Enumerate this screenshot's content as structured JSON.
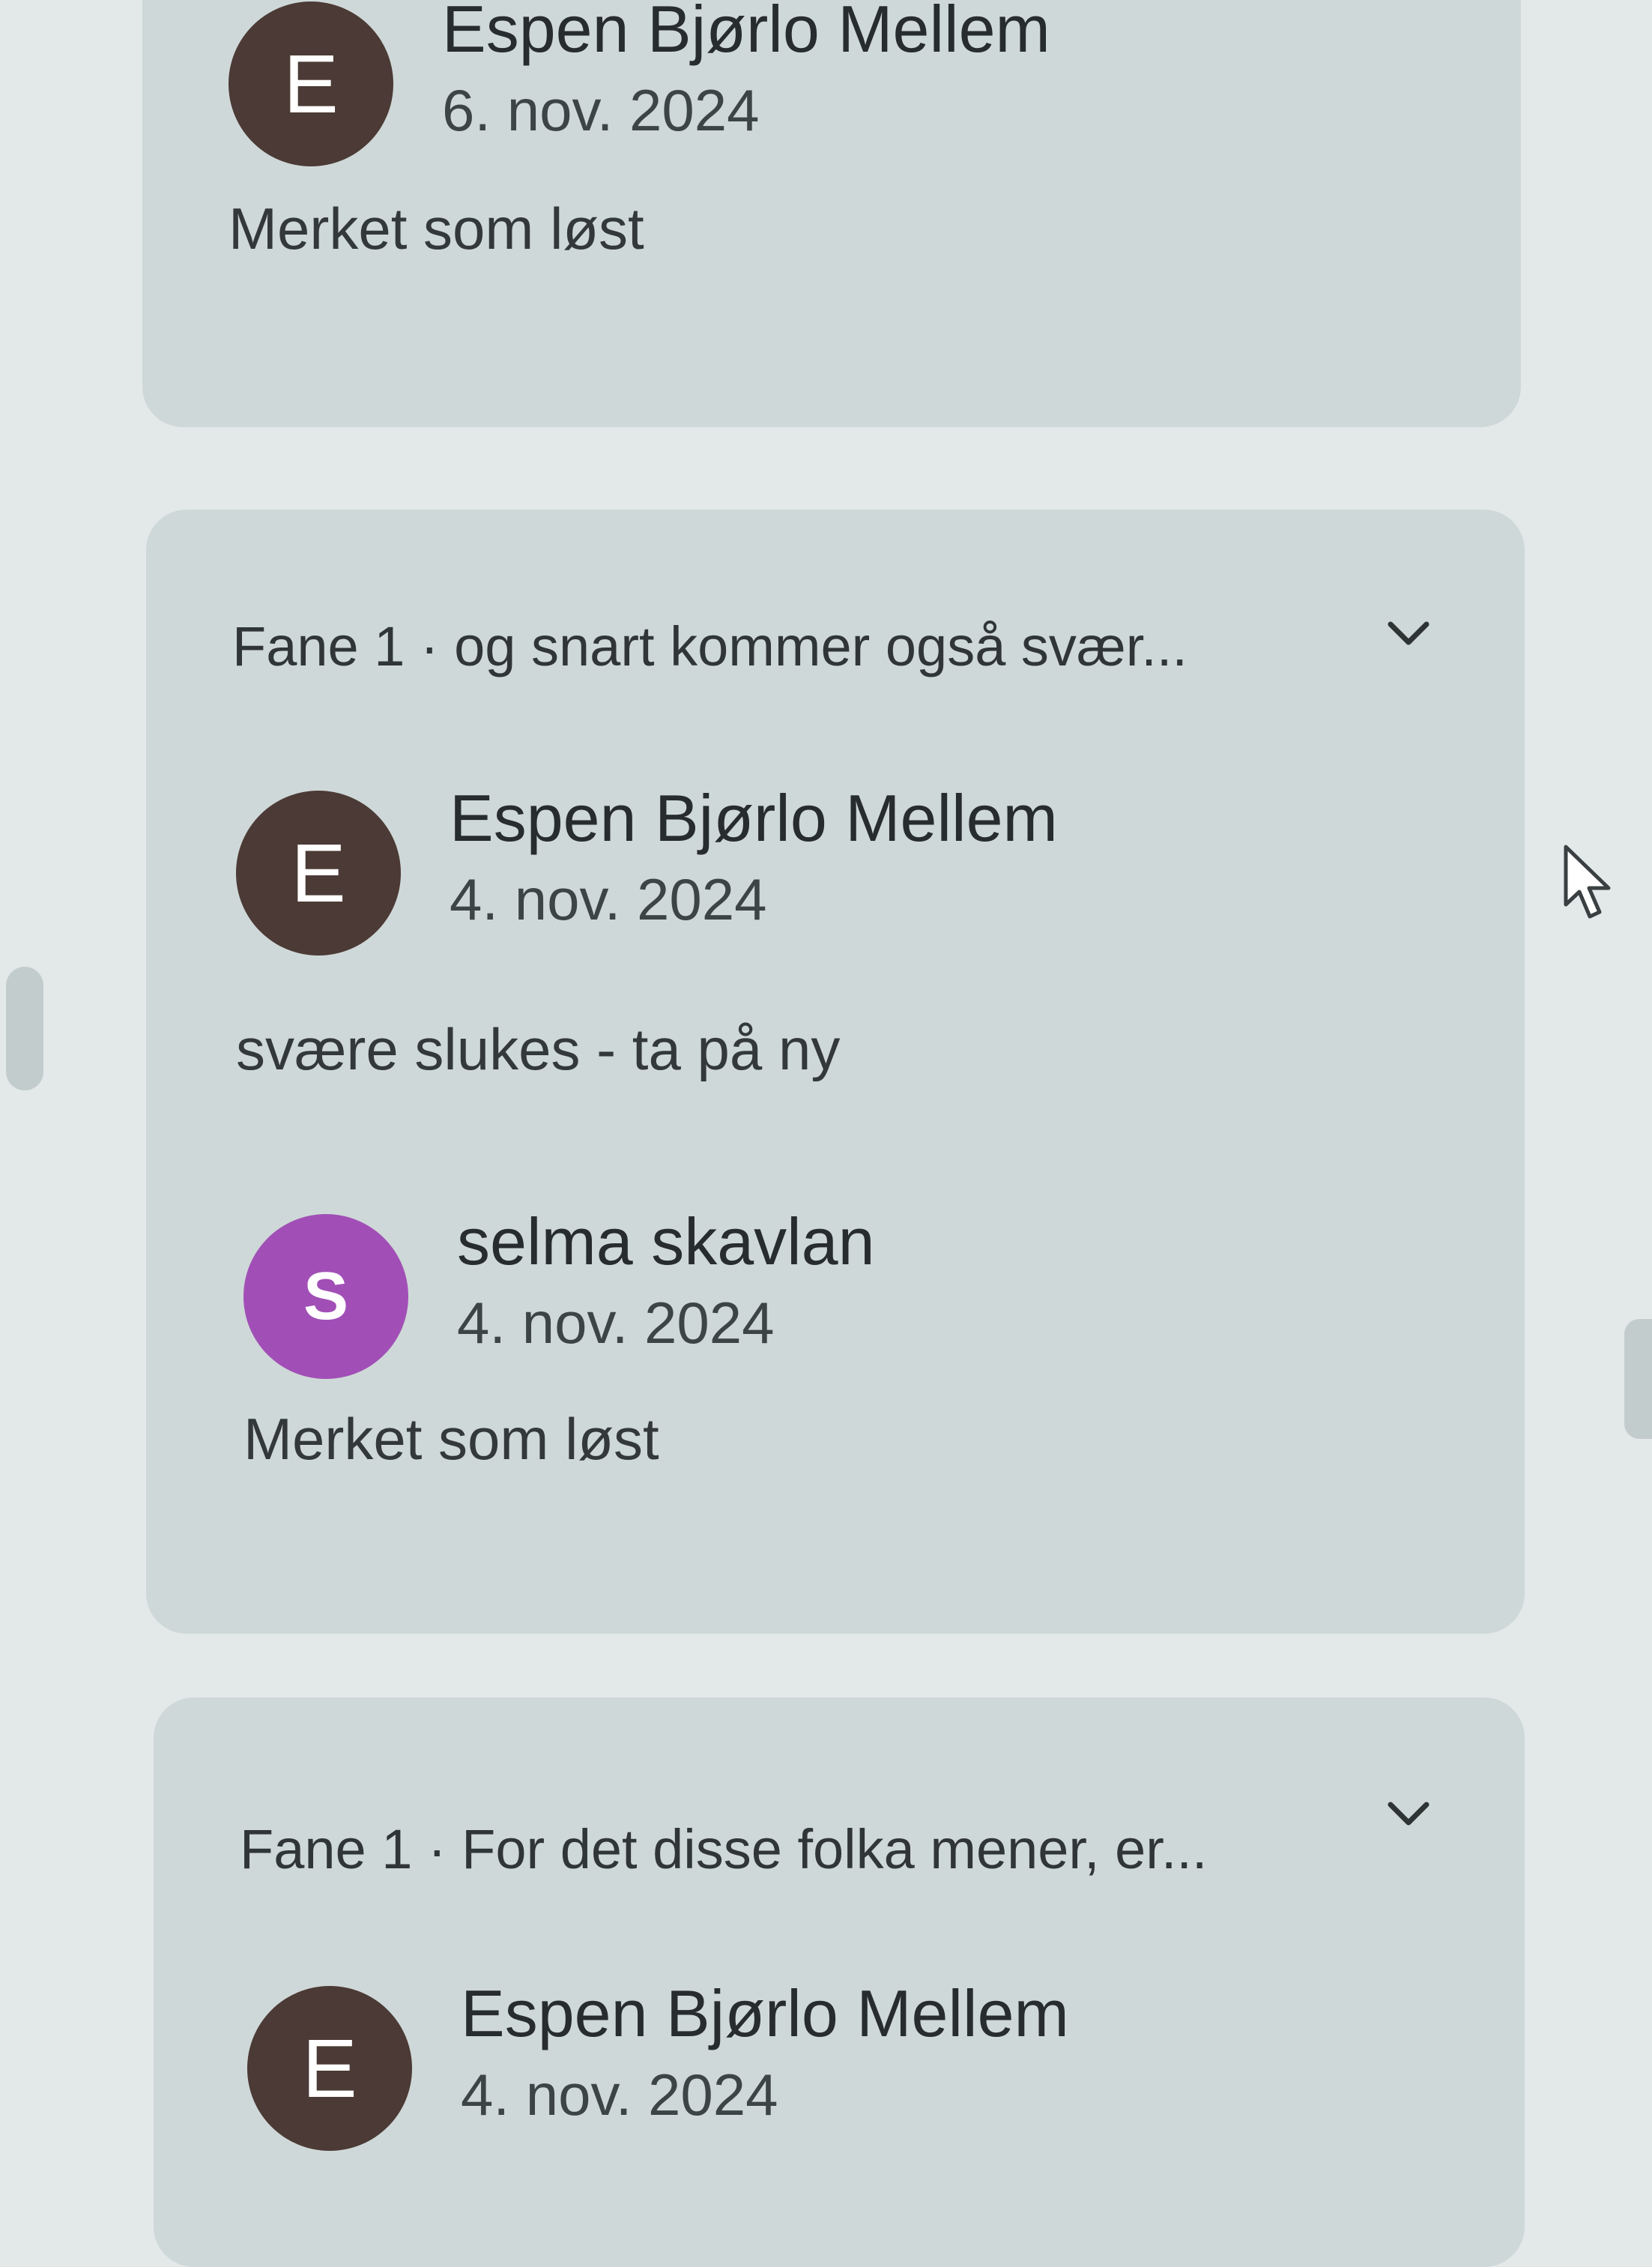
{
  "threads": [
    {
      "comments": [
        {
          "initial": "E",
          "author": "Espen Bjørlo Mellem",
          "date": "6. nov. 2024",
          "text": "Merket som løst"
        }
      ]
    },
    {
      "header": "Fane 1 · og snart kommer også svær...",
      "comments": [
        {
          "initial": "E",
          "author": "Espen Bjørlo Mellem",
          "date": "4. nov. 2024",
          "text": "svære slukes - ta på ny"
        },
        {
          "initial": "S",
          "author": "selma skavlan",
          "date": "4. nov. 2024",
          "text": "Merket som løst"
        }
      ]
    },
    {
      "header": "Fane 1 · For det disse folka mener, er...",
      "comments": [
        {
          "initial": "E",
          "author": "Espen Bjørlo Mellem",
          "date": "4. nov. 2024"
        }
      ]
    }
  ],
  "colors": {
    "avatar_e": "#4b3a35",
    "avatar_s": "#a14fb6",
    "card_background": "#cfd8d8",
    "page_background": "#e3e9e8"
  },
  "icons": [
    "chevron-down-icon",
    "mouse-pointer-icon"
  ]
}
